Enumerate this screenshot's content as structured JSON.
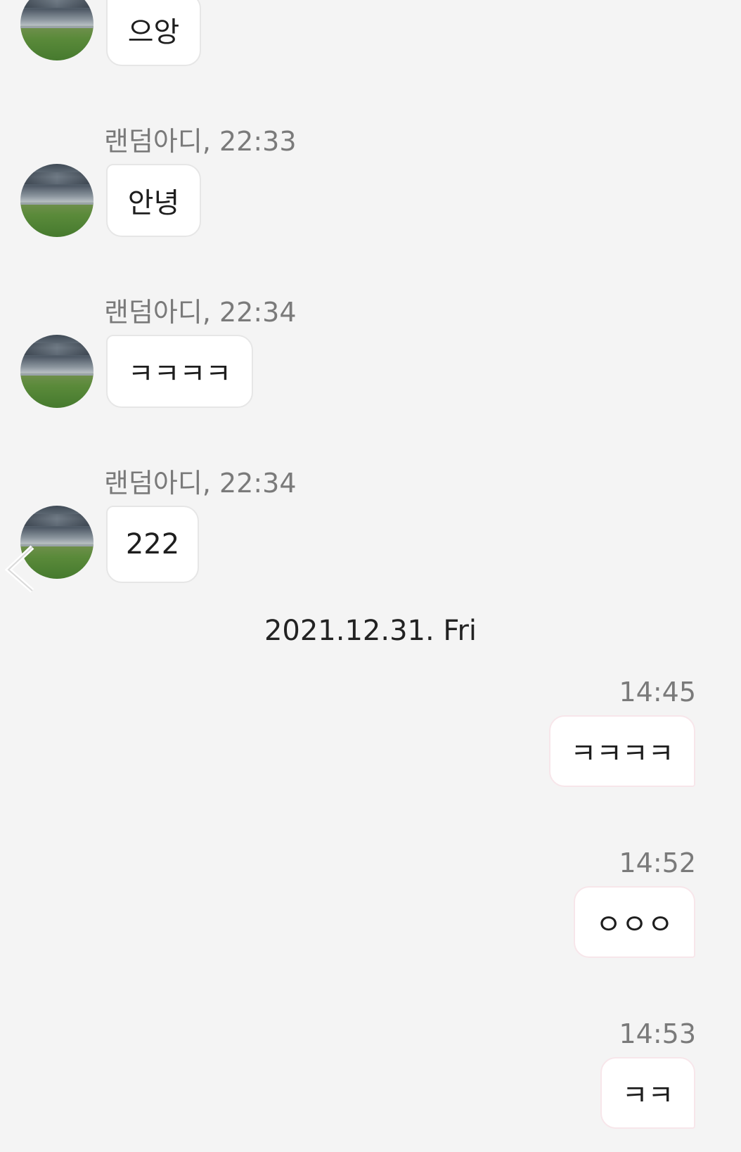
{
  "incoming": [
    {
      "sender": "",
      "text": "으앙"
    },
    {
      "sender": "랜덤아디, 22:33",
      "text": "안녕"
    },
    {
      "sender": "랜덤아디, 22:34",
      "text": "ㅋㅋㅋㅋ"
    },
    {
      "sender": "랜덤아디, 22:34",
      "text": "222"
    }
  ],
  "date_divider": "2021.12.31. Fri",
  "outgoing": [
    {
      "time": "14:45",
      "text": "ㅋㅋㅋㅋ"
    },
    {
      "time": "14:52",
      "text": "ㅇㅇㅇ"
    },
    {
      "time": "14:53",
      "text": "ㅋㅋ"
    }
  ],
  "icons": {
    "back": "chevron-left-icon",
    "avatar": "landscape-avatar"
  },
  "colors": {
    "background": "#f4f4f4",
    "bubble": "#ffffff",
    "meta_text": "#7a7a7a"
  }
}
